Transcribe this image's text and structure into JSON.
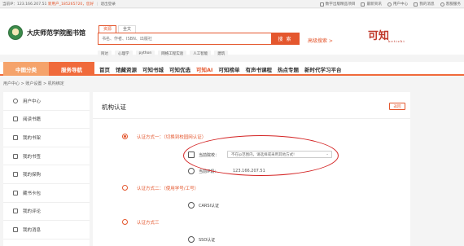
{
  "topbar": {
    "ip_text": "当前IP：123.166.207.51",
    "user_text": "新用户_185265720，您好",
    "logout": "退出登录",
    "links": [
      "数字出版精品项目",
      "最新资讯",
      "用户中心",
      "我的消息",
      "客服服务"
    ]
  },
  "header": {
    "library_name": "大庆师范学院图书馆",
    "search_tabs": [
      "资源",
      "全文"
    ],
    "search_placeholder": "书名、作者、ISBN、出版社",
    "search_button": "搜 索",
    "hotwords": [
      "阿达",
      "心理学",
      "python",
      "网络工程实验",
      "人工智能",
      "建筑"
    ],
    "advanced_search": "高级搜索 >",
    "brand": "可知",
    "brand_sub": "ketizhi"
  },
  "nav": {
    "categories": [
      "中图分类",
      "服务导航"
    ],
    "items": [
      "首页",
      "馆藏资源",
      "可知书城",
      "可知优选",
      "可知AI",
      "可知榜单",
      "有声书课程",
      "热点专题",
      "新时代学习平台"
    ],
    "active_item": "可知AI"
  },
  "breadcrumb": "用户中心 > 账户设置 > 机构绑定",
  "sidebar": {
    "items": [
      {
        "label": "用户中心",
        "icon": "user-icon"
      },
      {
        "label": "阅读书籍",
        "icon": "book-icon"
      },
      {
        "label": "我的书架",
        "icon": "bookshelf-icon"
      },
      {
        "label": "我的书签",
        "icon": "bookmark-icon"
      },
      {
        "label": "我的探购",
        "icon": "cart-icon"
      },
      {
        "label": "藏书卡包",
        "icon": "card-icon"
      },
      {
        "label": "我的评论",
        "icon": "comment-icon"
      },
      {
        "label": "我的消息",
        "icon": "message-icon"
      }
    ]
  },
  "main": {
    "title": "机构认证",
    "back_button": "返回",
    "methods": [
      {
        "label": "认证方式一：（切换到校园网认证）",
        "checked": true
      },
      {
        "label": "认证方式二：（使用学号/工号）",
        "checked": false
      },
      {
        "label": "认证方式三",
        "checked": false
      }
    ],
    "current_school_label": "当前院校：",
    "current_school_value": "不在ip范围内，请选择或采用其他方式!",
    "current_ip_label": "当前IP段：",
    "current_ip_value": "123.166.207.51",
    "carsi_label": "CARSI认证",
    "sso_label": "SSO认证"
  },
  "colors": {
    "accent": "#e4572e",
    "nav_cat_1": "#f5a36b",
    "nav_cat_2": "#f06a3b",
    "highlight": "#d42424"
  }
}
